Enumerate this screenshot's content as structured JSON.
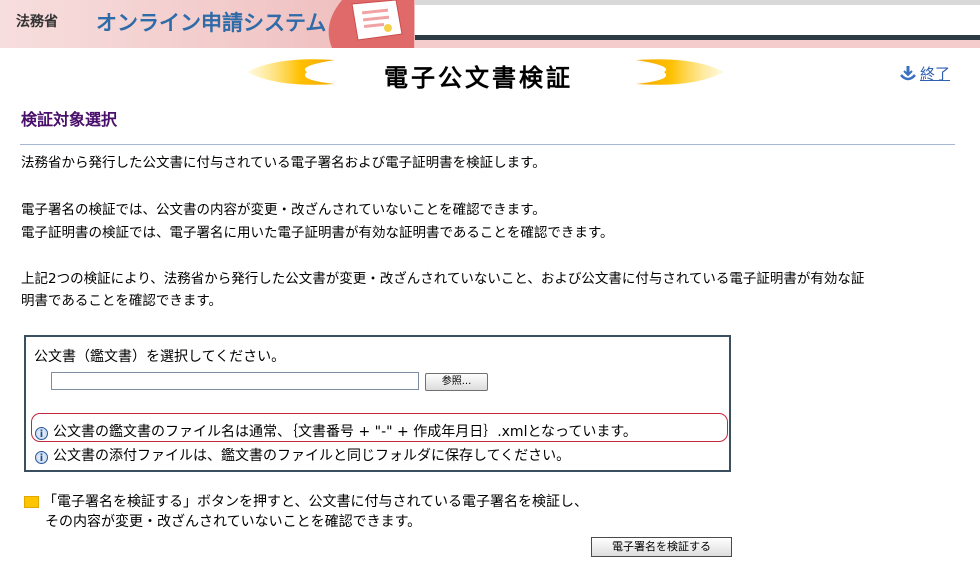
{
  "header": {
    "ministry": "法務省",
    "system_title": "オンライン申請システム"
  },
  "title_bar": {
    "title": "電子公文書検証",
    "exit_label": "終了"
  },
  "section": {
    "title": "検証対象選択"
  },
  "intro": {
    "line1": "法務省から発行した公文書に付与されている電子署名および電子証明書を検証します。",
    "line2": "電子署名の検証では、公文書の内容が変更・改ざんされていないことを確認できます。",
    "line3": "電子証明書の検証では、電子署名に用いた電子証明書が有効な証明書であることを確認できます。",
    "line4": "上記2つの検証により、法務省から発行した公文書が変更・改ざんされていないこと、および公文書に付与されている電子証明書が有効な証",
    "line5": "明書であることを確認できます。"
  },
  "select_box": {
    "label": "公文書（鑑文書）を選択してください。",
    "file_value": "",
    "browse_label": "参照...",
    "note1": "公文書の鑑文書のファイル名は通常、｛文書番号 + \"-\" + 作成年月日｝.xmlとなっています。",
    "note2": "公文書の添付ファイルは、鑑文書のファイルと同じフォルダに保存してください。"
  },
  "bottom": {
    "line1": "「電子署名を検証する」ボタンを押すと、公文書に付与されている電子署名を検証し、",
    "line2": "その内容が変更・改ざんされていないことを確認できます。",
    "verify_label": "電子署名を検証する"
  }
}
